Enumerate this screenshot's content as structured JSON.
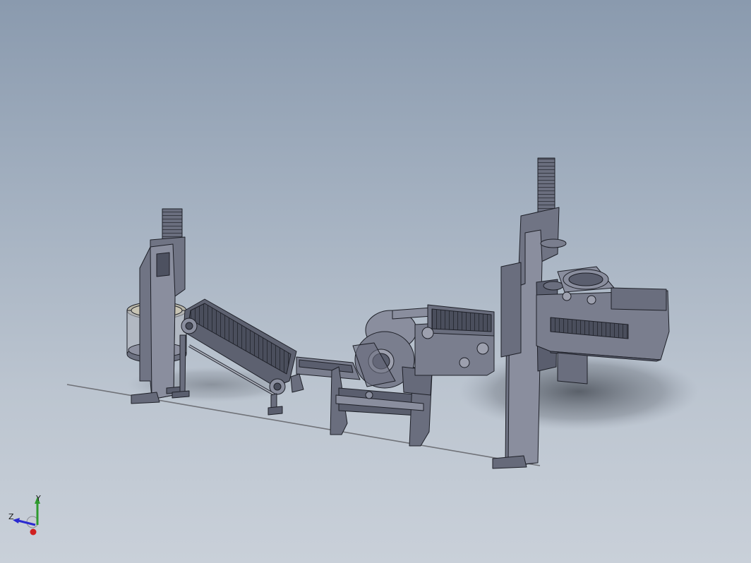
{
  "viewport": {
    "background_top": "#8a9aae",
    "background_bottom": "#c9d0d9",
    "model_color": "#6f7383",
    "model_dark": "#3e4250",
    "model_light": "#9ea2b0"
  },
  "triad": {
    "y_label": "Y",
    "z_label": "Z",
    "colors": {
      "y": "#2e9a2e",
      "z": "#2a2ad0",
      "x": "#d02020"
    }
  }
}
